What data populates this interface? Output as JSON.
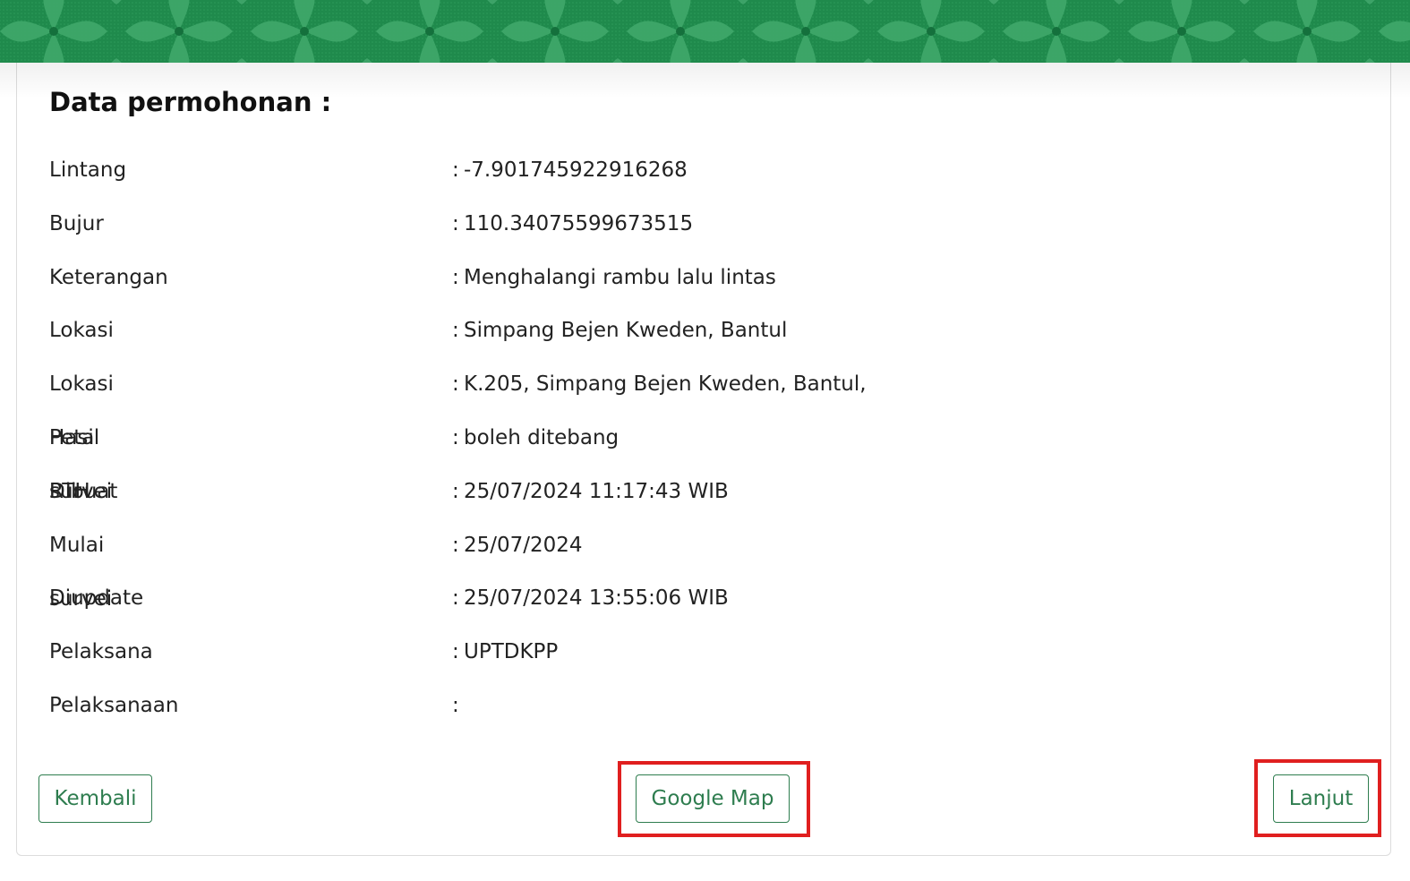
{
  "banner": {
    "colors": {
      "base": "#1f8a4c",
      "light": "#4fb37a",
      "dark": "#14703c"
    }
  },
  "section": {
    "title": "Data permohonan :"
  },
  "separator": ":",
  "rows": [
    {
      "label": "Lintang",
      "value": "-7.901745922916268"
    },
    {
      "label": "Bujur",
      "value": "110.34075599673515"
    },
    {
      "label": "Keterangan",
      "value": "Menghalangi rambu lalu lintas"
    },
    {
      "label": "Lokasi",
      "value": "Simpang Bejen Kweden, Bantul"
    },
    {
      "label": "Lokasi Peta RTH",
      "value": "K.205, Simpang Bejen Kweden, Bantul,"
    },
    {
      "label": "Hasil survei",
      "value": "boleh ditebang"
    },
    {
      "label": "Dibuat",
      "value": "25/07/2024 11:17:43 WIB"
    },
    {
      "label": "Mulai survei",
      "value": "25/07/2024"
    },
    {
      "label": "Diupdate",
      "value": "25/07/2024 13:55:06 WIB"
    },
    {
      "label": "Pelaksana",
      "value": "UPTDKPP"
    },
    {
      "label": "Pelaksanaan",
      "value": ""
    }
  ],
  "buttons": {
    "back": "Kembali",
    "map": "Google Map",
    "next": "Lanjut"
  },
  "colors": {
    "accent": "#2e7d4f",
    "highlight": "#e01f1f"
  }
}
